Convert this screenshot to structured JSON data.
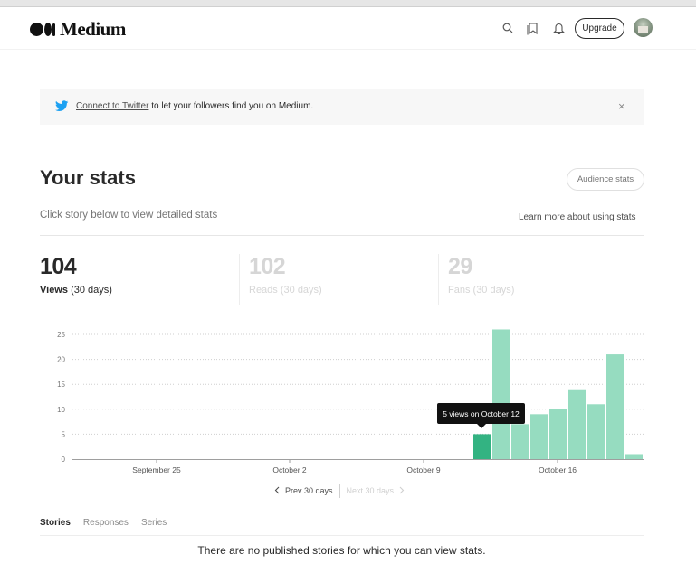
{
  "app": {
    "name": "Medium"
  },
  "header": {
    "icons": {
      "search": "search-icon",
      "bookmarks": "bookmarks-icon",
      "notifications": "bell-icon"
    },
    "upgrade_label": "Upgrade"
  },
  "banner": {
    "link_text": "Connect to Twitter",
    "text": " to let your followers find you on Medium.",
    "close_symbol": "×"
  },
  "page": {
    "title": "Your stats",
    "subtitle": "Click story below to view detailed stats",
    "audience_button": "Audience stats",
    "learn_more": "Learn more about using stats"
  },
  "summary": [
    {
      "value": "104",
      "label": "Views",
      "period": "(30 days)"
    },
    {
      "value": "102",
      "label": "Reads",
      "period": "(30 days)"
    },
    {
      "value": "29",
      "label": "Fans",
      "period": "(30 days)"
    }
  ],
  "tooltip": "5 views on October 12",
  "pager": {
    "prev": "Prev 30 days",
    "next": "Next 30 days"
  },
  "tabs": [
    "Stories",
    "Responses",
    "Series"
  ],
  "empty_message": "There are no published stories for which you can view stats.",
  "colors": {
    "bar": "#96dcc0",
    "bar_active": "#33b382",
    "text": "#292929",
    "muted": "#757575"
  },
  "chart_data": {
    "type": "bar",
    "ylim": [
      0,
      25
    ],
    "yticks": [
      0,
      5,
      10,
      15,
      20,
      25
    ],
    "grid": true,
    "xlabels": [
      "September 25",
      "October 2",
      "October 9",
      "October 16"
    ],
    "x": [
      "Oct 12",
      "Oct 13",
      "Oct 14",
      "Oct 15",
      "Oct 16",
      "Oct 17",
      "Oct 18",
      "Oct 19",
      "Oct 20"
    ],
    "values": [
      5,
      26,
      7,
      9,
      10,
      14,
      11,
      21,
      1
    ],
    "highlight_index": 0
  }
}
